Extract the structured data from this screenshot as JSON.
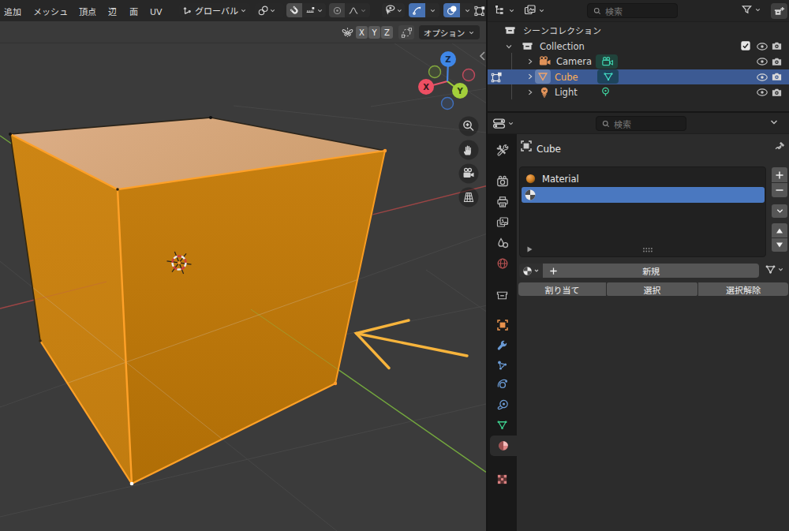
{
  "app": {
    "name_hint": "blender-3d-viewport",
    "colors": {
      "accent_blue": "#4772b3",
      "outliner_selection": "#3c5a93",
      "list_selection": "#4a78c0",
      "active_object_text": "#ffb057",
      "cube_top_face": "#d9ab82",
      "cube_left_face": "#c98212",
      "cube_right_face": "#bd780c",
      "selected_edge": "#ffa128",
      "annotation_arrow": "#f7b43c",
      "axis_x": "#9c4545",
      "axis_y": "#74a83e",
      "viewport_bg": "#3b3b3b"
    }
  },
  "viewport": {
    "menus": [
      {
        "label": "追加"
      },
      {
        "label": "メッシュ"
      },
      {
        "label": "頂点"
      },
      {
        "label": "辺"
      },
      {
        "label": "面"
      },
      {
        "label": "UV"
      }
    ],
    "transform_orientation": "グローバル",
    "tool_settings": {
      "options_label": "オプション",
      "mirror_x": "X",
      "mirror_y": "Y",
      "mirror_z": "Z"
    },
    "gizmo": {
      "x": "X",
      "y": "Y",
      "z": "Z"
    }
  },
  "outliner": {
    "search_placeholder": "検索",
    "scene_collection_label": "シーンコレクション",
    "collection_label": "Collection",
    "objects": [
      {
        "label": "Camera"
      },
      {
        "label": "Cube"
      },
      {
        "label": "Light"
      }
    ]
  },
  "properties": {
    "search_placeholder": "検索",
    "breadcrumb": "Cube",
    "material_slot_name": "Material",
    "new_button": "新規",
    "assign_button": "割り当て",
    "select_button": "選択",
    "deselect_button": "選択解除"
  }
}
